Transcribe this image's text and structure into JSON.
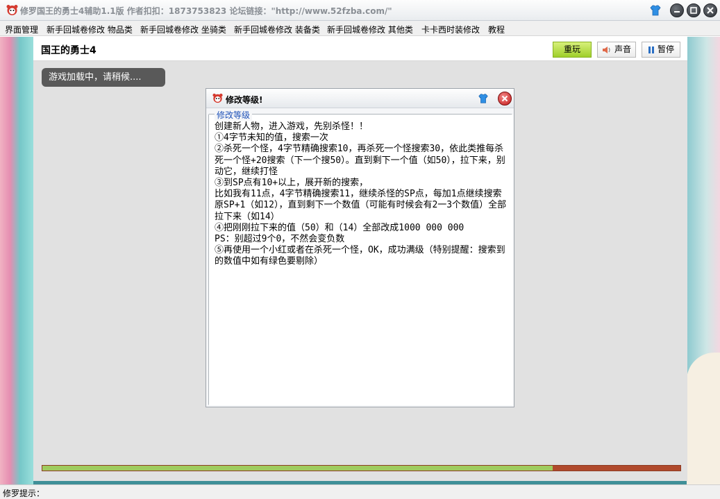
{
  "window": {
    "title": "修罗国王的勇士4辅助1.1版    作者扣扣：1873753823    论坛链接：\"http://www.52fzba.com/\"",
    "icon": "app-mascot-icon"
  },
  "menu": {
    "items": [
      {
        "label": "界面管理"
      },
      {
        "label": "新手回城卷修改 物品类"
      },
      {
        "label": "新手回城卷修改 坐骑类"
      },
      {
        "label": "新手回城卷修改 装备类"
      },
      {
        "label": "新手回城卷修改 其他类"
      },
      {
        "label": "卡卡西时装修改"
      },
      {
        "label": "教程"
      }
    ]
  },
  "game": {
    "title": "国王的勇士4",
    "replay_label": "重玩",
    "sound_label": "声音",
    "pause_label": "暂停",
    "loading_text": "游戏加载中，请稍候....",
    "progress": 0.8
  },
  "dialog": {
    "title": "修改等级!",
    "group_label": "修改等级",
    "text": "创建新人物，进入游戏，先别杀怪！！\n①4字节未知的值，搜索一次\n②杀死一个怪，4字节精确搜索10，再杀死一个怪搜索30，依此类推每杀死一个怪+20搜索（下一个搜50）。直到剩下一个值（如50），拉下来，别动它，继续打怪\n③到SP点有10+以上，展开新的搜索，\n比如我有11点，4字节精确搜索11，继续杀怪的SP点，每加1点继续搜索原SP+1（如12），直到剩下一个数值（可能有时候会有2一3个数值）全部拉下来（如14）\n④把刚刚拉下来的值（50）和（14）全部改成1000 000 000\nPS：别超过9个0，不然会变负数\n⑤再使用一个小红或者在杀死一个怪，OK，成功满级（特别提醒：搜索到的数值中如有绿色要剔除）"
  },
  "status": {
    "label": "修罗提示："
  },
  "colors": {
    "replay_bg": "#b5dd45",
    "progress_fill": "#9fcb5e",
    "progress_track": "#b04a2c",
    "group_label": "#1f52b8"
  }
}
